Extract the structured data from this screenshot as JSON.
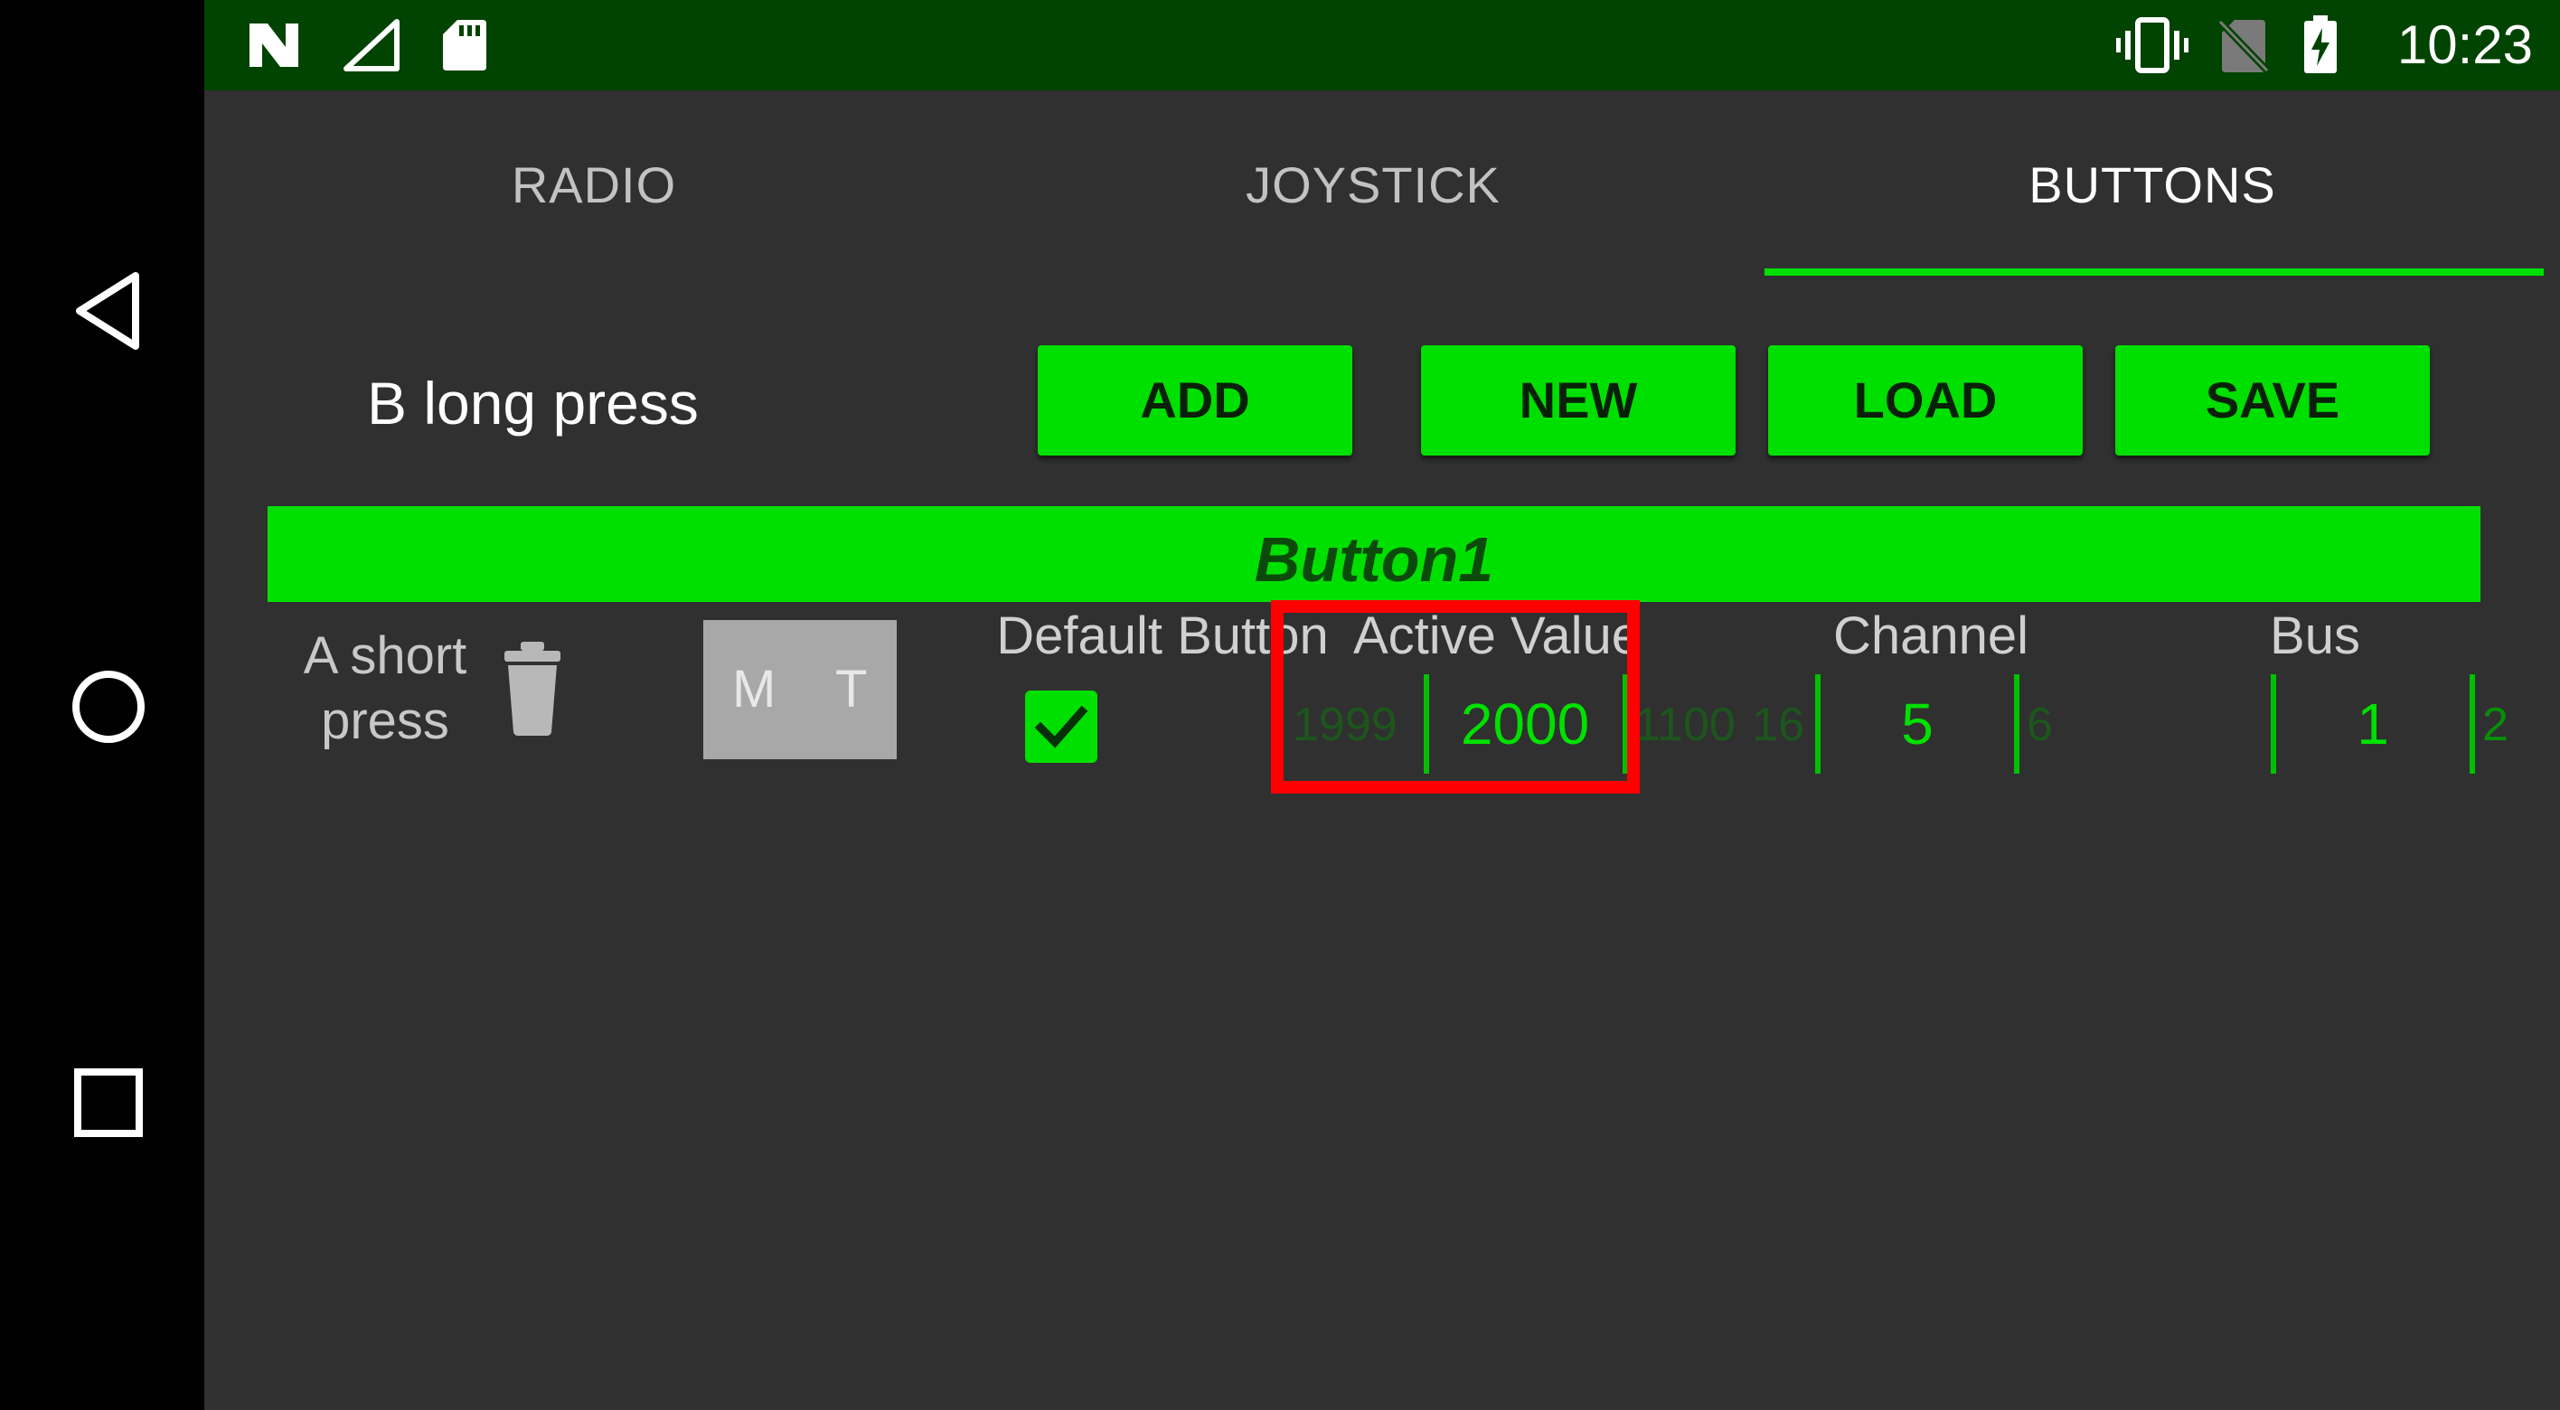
{
  "status_bar": {
    "time": "10:23",
    "icons": [
      "nfc-icon",
      "signal-icon",
      "sd-card-icon",
      "vibrate-icon",
      "no-sim-icon",
      "battery-charging-icon"
    ]
  },
  "tabs": [
    {
      "label": "RADIO",
      "active": false
    },
    {
      "label": "JOYSTICK",
      "active": false
    },
    {
      "label": "BUTTONS",
      "active": true
    }
  ],
  "toolbar": {
    "selected_button": "B long press",
    "add_label": "ADD",
    "new_label": "NEW",
    "load_label": "LOAD",
    "save_label": "SAVE"
  },
  "section_title": "Button1",
  "row": {
    "name": "A short press",
    "mode_m": "M",
    "mode_t": "T",
    "default_label": "Default Button",
    "default_checked": true,
    "active_label": "Active Value",
    "active_prev": "1999",
    "active_value": "2000",
    "active_next": "1100",
    "channel_label": "Channel",
    "channel_prev": "16",
    "channel_value": "5",
    "channel_next": "6",
    "bus_label": "Bus",
    "bus_value": "1",
    "bus_next": "2"
  },
  "colors": {
    "accent": "#00e000",
    "status_bar": "#014301",
    "background": "#303030",
    "highlight": "#ff0000"
  }
}
